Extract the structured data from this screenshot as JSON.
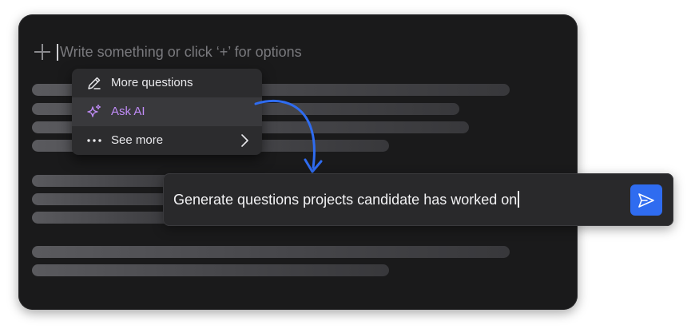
{
  "editor": {
    "placeholder": "Write something or click ‘+’ for options"
  },
  "menu": {
    "items": [
      {
        "label": "More questions",
        "icon": "pencil-icon"
      },
      {
        "label": "Ask AI",
        "icon": "sparkle-icon"
      },
      {
        "label": "See more",
        "icon": "more-dots-icon"
      }
    ]
  },
  "prompt": {
    "value": "Generate questions projects candidate has worked on",
    "send_icon": "send-icon"
  },
  "colors": {
    "accent_purple": "#c08cf7",
    "arrow_blue": "#2f6cf0",
    "send_blue": "#2f6cf0"
  }
}
